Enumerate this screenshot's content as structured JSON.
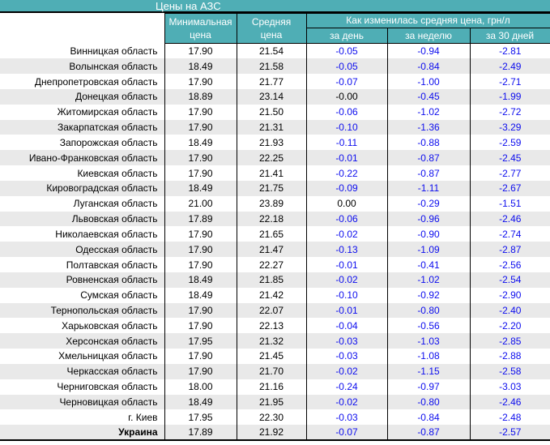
{
  "title": "Цены на АЗС",
  "colors": {
    "teal_header": "#4FAEB5",
    "stripe_row": "#E9E9E9",
    "change_value_blue": "#0D0DEE",
    "change_value_zero_black": "#000000",
    "border_black": "#000000",
    "header_text_white": "#FFFFFF"
  },
  "header": {
    "min_price_line1": "Минимальная",
    "min_price_line2": "цена",
    "avg_price_line1": "Средняя",
    "avg_price_line2": "цена",
    "change_group": "Как изменилась средняя цена, грн/л",
    "change_cols": [
      "за день",
      "за неделю",
      "за 30 дней"
    ]
  },
  "rows": [
    {
      "region": "Винницкая область",
      "min": "17.90",
      "avg": "21.54",
      "day": "-0.05",
      "week": "-0.94",
      "month": "-2.81"
    },
    {
      "region": "Волынская область",
      "min": "18.49",
      "avg": "21.58",
      "day": "-0.05",
      "week": "-0.84",
      "month": "-2.49"
    },
    {
      "region": "Днепропетровская область",
      "min": "17.90",
      "avg": "21.77",
      "day": "-0.07",
      "week": "-1.00",
      "month": "-2.71"
    },
    {
      "region": "Донецкая область",
      "min": "18.89",
      "avg": "23.14",
      "day": "-0.00",
      "week": "-0.45",
      "month": "-1.99"
    },
    {
      "region": "Житомирская область",
      "min": "17.90",
      "avg": "21.50",
      "day": "-0.06",
      "week": "-1.02",
      "month": "-2.72"
    },
    {
      "region": "Закарпатская область",
      "min": "17.90",
      "avg": "21.31",
      "day": "-0.10",
      "week": "-1.36",
      "month": "-3.29"
    },
    {
      "region": "Запорожская область",
      "min": "18.49",
      "avg": "21.93",
      "day": "-0.11",
      "week": "-0.88",
      "month": "-2.59"
    },
    {
      "region": "Ивано-Франковская область",
      "min": "17.90",
      "avg": "22.25",
      "day": "-0.01",
      "week": "-0.87",
      "month": "-2.45"
    },
    {
      "region": "Киевская область",
      "min": "17.90",
      "avg": "21.41",
      "day": "-0.22",
      "week": "-0.87",
      "month": "-2.77"
    },
    {
      "region": "Кировоградская область",
      "min": "18.49",
      "avg": "21.75",
      "day": "-0.09",
      "week": "-1.11",
      "month": "-2.67"
    },
    {
      "region": "Луганская область",
      "min": "21.00",
      "avg": "23.89",
      "day": "0.00",
      "week": "-0.29",
      "month": "-1.51"
    },
    {
      "region": "Львовская область",
      "min": "17.89",
      "avg": "22.18",
      "day": "-0.06",
      "week": "-0.96",
      "month": "-2.46"
    },
    {
      "region": "Николаевская область",
      "min": "17.90",
      "avg": "21.65",
      "day": "-0.02",
      "week": "-0.90",
      "month": "-2.74"
    },
    {
      "region": "Одесская область",
      "min": "17.90",
      "avg": "21.47",
      "day": "-0.13",
      "week": "-1.09",
      "month": "-2.87"
    },
    {
      "region": "Полтавская область",
      "min": "17.90",
      "avg": "22.27",
      "day": "-0.01",
      "week": "-0.41",
      "month": "-2.56"
    },
    {
      "region": "Ровненская область",
      "min": "18.49",
      "avg": "21.85",
      "day": "-0.02",
      "week": "-1.02",
      "month": "-2.54"
    },
    {
      "region": "Сумская область",
      "min": "18.49",
      "avg": "21.42",
      "day": "-0.10",
      "week": "-0.92",
      "month": "-2.90"
    },
    {
      "region": "Тернопольская область",
      "min": "17.90",
      "avg": "22.07",
      "day": "-0.01",
      "week": "-0.80",
      "month": "-2.40"
    },
    {
      "region": "Харьковская область",
      "min": "17.90",
      "avg": "22.13",
      "day": "-0.04",
      "week": "-0.56",
      "month": "-2.20"
    },
    {
      "region": "Херсонская область",
      "min": "17.95",
      "avg": "21.32",
      "day": "-0.03",
      "week": "-1.03",
      "month": "-2.85"
    },
    {
      "region": "Хмельницкая область",
      "min": "17.90",
      "avg": "21.45",
      "day": "-0.03",
      "week": "-1.08",
      "month": "-2.88"
    },
    {
      "region": "Черкасская область",
      "min": "17.90",
      "avg": "21.70",
      "day": "-0.02",
      "week": "-1.15",
      "month": "-2.58"
    },
    {
      "region": "Черниговская область",
      "min": "18.00",
      "avg": "21.16",
      "day": "-0.24",
      "week": "-0.97",
      "month": "-3.03"
    },
    {
      "region": "Черновицкая область",
      "min": "18.49",
      "avg": "21.95",
      "day": "-0.02",
      "week": "-0.80",
      "month": "-2.46"
    },
    {
      "region": "г. Киев",
      "min": "17.95",
      "avg": "22.30",
      "day": "-0.03",
      "week": "-0.84",
      "month": "-2.48"
    },
    {
      "region": "Украина",
      "min": "17.89",
      "avg": "21.92",
      "day": "-0.07",
      "week": "-0.87",
      "month": "-2.57",
      "bold": true
    }
  ]
}
